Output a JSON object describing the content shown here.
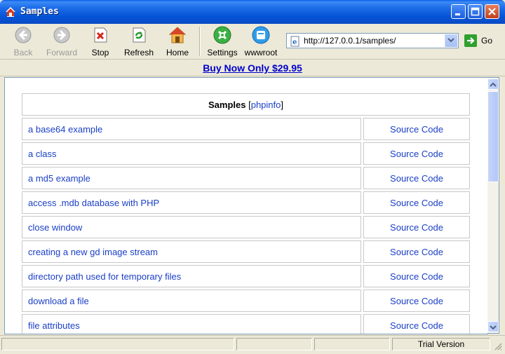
{
  "window": {
    "title": "Samples"
  },
  "toolbar": {
    "back": "Back",
    "forward": "Forward",
    "stop": "Stop",
    "refresh": "Refresh",
    "home": "Home",
    "settings": "Settings",
    "wwwroot": "wwwroot",
    "address": "http://127.0.0.1/samples/",
    "go": "Go"
  },
  "promo": {
    "text": "Buy Now Only $29.95"
  },
  "samples": {
    "heading": "Samples",
    "phpinfo": "phpinfo",
    "bracket_open": "[",
    "bracket_close": "]",
    "rows": [
      {
        "name": "a base64 example",
        "source": "Source Code"
      },
      {
        "name": "a class",
        "source": "Source Code"
      },
      {
        "name": "a md5 example",
        "source": "Source Code"
      },
      {
        "name": "access .mdb database with PHP",
        "source": "Source Code"
      },
      {
        "name": "close window",
        "source": "Source Code"
      },
      {
        "name": "creating a new gd image stream",
        "source": "Source Code"
      },
      {
        "name": "directory path used for temporary files",
        "source": "Source Code"
      },
      {
        "name": "download a file",
        "source": "Source Code"
      },
      {
        "name": "file attributes",
        "source": "Source Code"
      }
    ]
  },
  "status": {
    "license": "Trial Version"
  },
  "icons": {
    "app": "home-icon",
    "back": "back-arrow-icon",
    "forward": "forward-arrow-icon",
    "stop": "stop-icon",
    "refresh": "refresh-icon",
    "home": "home-icon",
    "settings": "settings-icon",
    "wwwroot": "folder-icon",
    "address": "ie-page-icon",
    "go": "go-arrow-icon"
  },
  "colors": {
    "titlebar": "#0553d6",
    "link": "#1a3fc6",
    "promo_link": "#0000cc",
    "chrome": "#ece9d8"
  }
}
